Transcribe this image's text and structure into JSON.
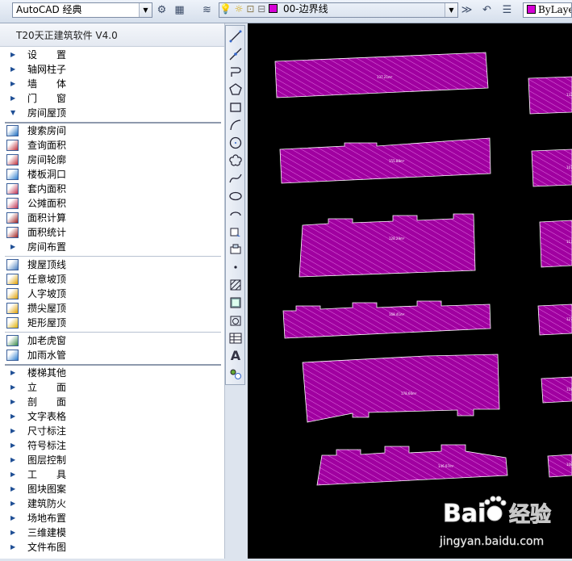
{
  "toolbar": {
    "workspace": "AutoCAD 经典",
    "layer": "00-边界线",
    "color": "ByLayer",
    "layer_color": "#d600d6"
  },
  "panel": {
    "title": "T20天正建筑软件 V4.0",
    "top_items": [
      "设　　置",
      "轴网柱子",
      "墙　　体",
      "门　　窗",
      "房间屋顶"
    ],
    "room_tools": [
      "搜索房间",
      "查询面积",
      "房间轮廓",
      "楼板洞口",
      "套内面积",
      "公摊面积",
      "面积计算",
      "面积统计",
      "房间布置"
    ],
    "roof_tools": [
      "搜屋顶线",
      "任意坡顶",
      "人字坡顶",
      "攒尖屋顶",
      "矩形屋顶"
    ],
    "extra_tools": [
      "加老虎窗",
      "加雨水管"
    ],
    "bottom_items": [
      "楼梯其他",
      "立　　面",
      "剖　　面",
      "文字表格",
      "尺寸标注",
      "符号标注",
      "图层控制",
      "工　　具",
      "图块图案",
      "建筑防火",
      "场地布置",
      "三维建模",
      "文件布图"
    ]
  },
  "drawbar": {
    "tools": [
      "line-icon",
      "construction-line-icon",
      "polyline-icon",
      "polygon-icon",
      "rectangle-icon",
      "arc-icon",
      "circle-icon",
      "revision-cloud-icon",
      "spline-icon",
      "ellipse-icon",
      "ellipse-arc-icon",
      "insert-block-icon",
      "make-block-icon",
      "point-icon",
      "hatch-icon",
      "gradient-icon",
      "region-icon",
      "table-icon",
      "multiline-text-icon",
      "add-selected-icon"
    ],
    "text_glyph": "A"
  },
  "canvas": {
    "hatch_color": "#a000a0",
    "outline_color": "#ffffff",
    "area_labels": [
      "137.21m²",
      "132.86m²",
      "155.88m²",
      "107.08m²",
      "128.29m²",
      "113.25m²",
      "168.41m²",
      "127.74m²",
      "178.66m²",
      "118.24m²",
      "146.07m²",
      "108.31m²",
      "107.12m²"
    ]
  },
  "watermark": {
    "brand_left": "Bai",
    "brand_right": "经验",
    "url": "jingyan.baidu.com"
  }
}
